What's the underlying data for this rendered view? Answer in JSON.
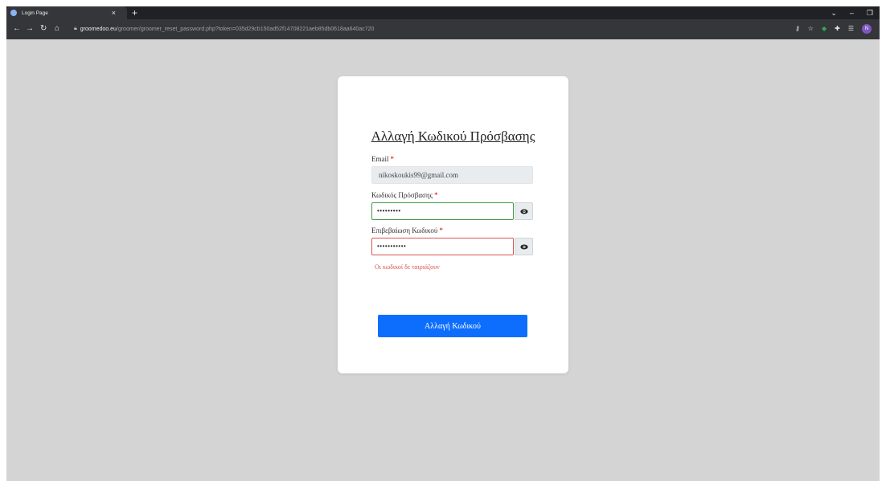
{
  "browser": {
    "tab_title": "Login Page",
    "tab_close": "×",
    "new_tab": "+",
    "url_host": "groomedoo.eu",
    "url_path": "/groomer/groomer_reset_password.php?token=035d29cb150ad52f14708221aeb85db0618aa640ac720",
    "avatar_letter": "N"
  },
  "form": {
    "title": "Αλλαγή Κωδικού Πρόσβασης",
    "required_mark": "*",
    "email_label": "Email",
    "email_value": "nikoskoukis99@gmail.com",
    "password_label": "Κωδικός Πρόσβασης",
    "password_value": "•••••••••",
    "confirm_label": "Επιβεβαίωση Κωδικού",
    "confirm_value": "•••••••••••",
    "error": "Οι κωδικοί δε ταιριάζουν",
    "submit_label": "Αλλαγή Κωδικού"
  },
  "colors": {
    "page_bg": "#d4d4d4",
    "primary": "#0d6efd",
    "valid_border": "#3f9a49",
    "invalid_border": "#d9534f"
  },
  "icons": [
    "back-arrow-icon",
    "forward-arrow-icon",
    "reload-icon",
    "home-icon",
    "lock-icon",
    "key-icon",
    "star-icon",
    "extension-icon",
    "eye-icon"
  ]
}
